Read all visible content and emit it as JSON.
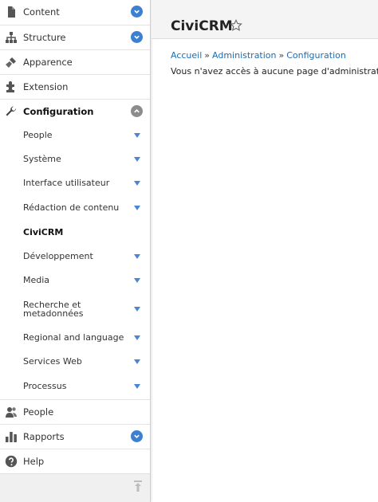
{
  "sidebar": {
    "top_items": [
      {
        "label": "Content",
        "icon": "file-icon",
        "button": "expand"
      },
      {
        "label": "Structure",
        "icon": "sitemap-icon",
        "button": "expand"
      },
      {
        "label": "Apparence",
        "icon": "brush-icon"
      },
      {
        "label": "Extension",
        "icon": "puzzle-icon"
      },
      {
        "label": "Configuration",
        "icon": "wrench-icon",
        "button": "collapse",
        "active": true
      }
    ],
    "sub_items": [
      {
        "label": "People"
      },
      {
        "label": "Système"
      },
      {
        "label": "Interface utilisateur"
      },
      {
        "label": "Rédaction de contenu"
      },
      {
        "label": "CiviCRM",
        "current": true
      },
      {
        "label": "Développement"
      },
      {
        "label": "Media"
      },
      {
        "label": "Recherche et metadonnées"
      },
      {
        "label": "Regional and language"
      },
      {
        "label": "Services Web"
      },
      {
        "label": "Processus"
      }
    ],
    "bottom_items": [
      {
        "label": "People",
        "icon": "people-icon"
      },
      {
        "label": "Rapports",
        "icon": "bar-chart-icon",
        "button": "expand"
      },
      {
        "label": "Help",
        "icon": "help-icon"
      }
    ],
    "footer": {
      "icon": "collapse-sidebar-icon"
    }
  },
  "header": {
    "title": "CiviCRM",
    "star_icon": "star-outline-icon"
  },
  "breadcrumb": [
    "Accueil",
    "Administration",
    "Configuration"
  ],
  "breadcrumb_separator": "»",
  "message": "Vous n'avez accès à aucune page d'administration.",
  "colors": {
    "accent": "#3f7fd0",
    "link": "#1f6cb0",
    "collapse_button": "#8c8c8c"
  }
}
